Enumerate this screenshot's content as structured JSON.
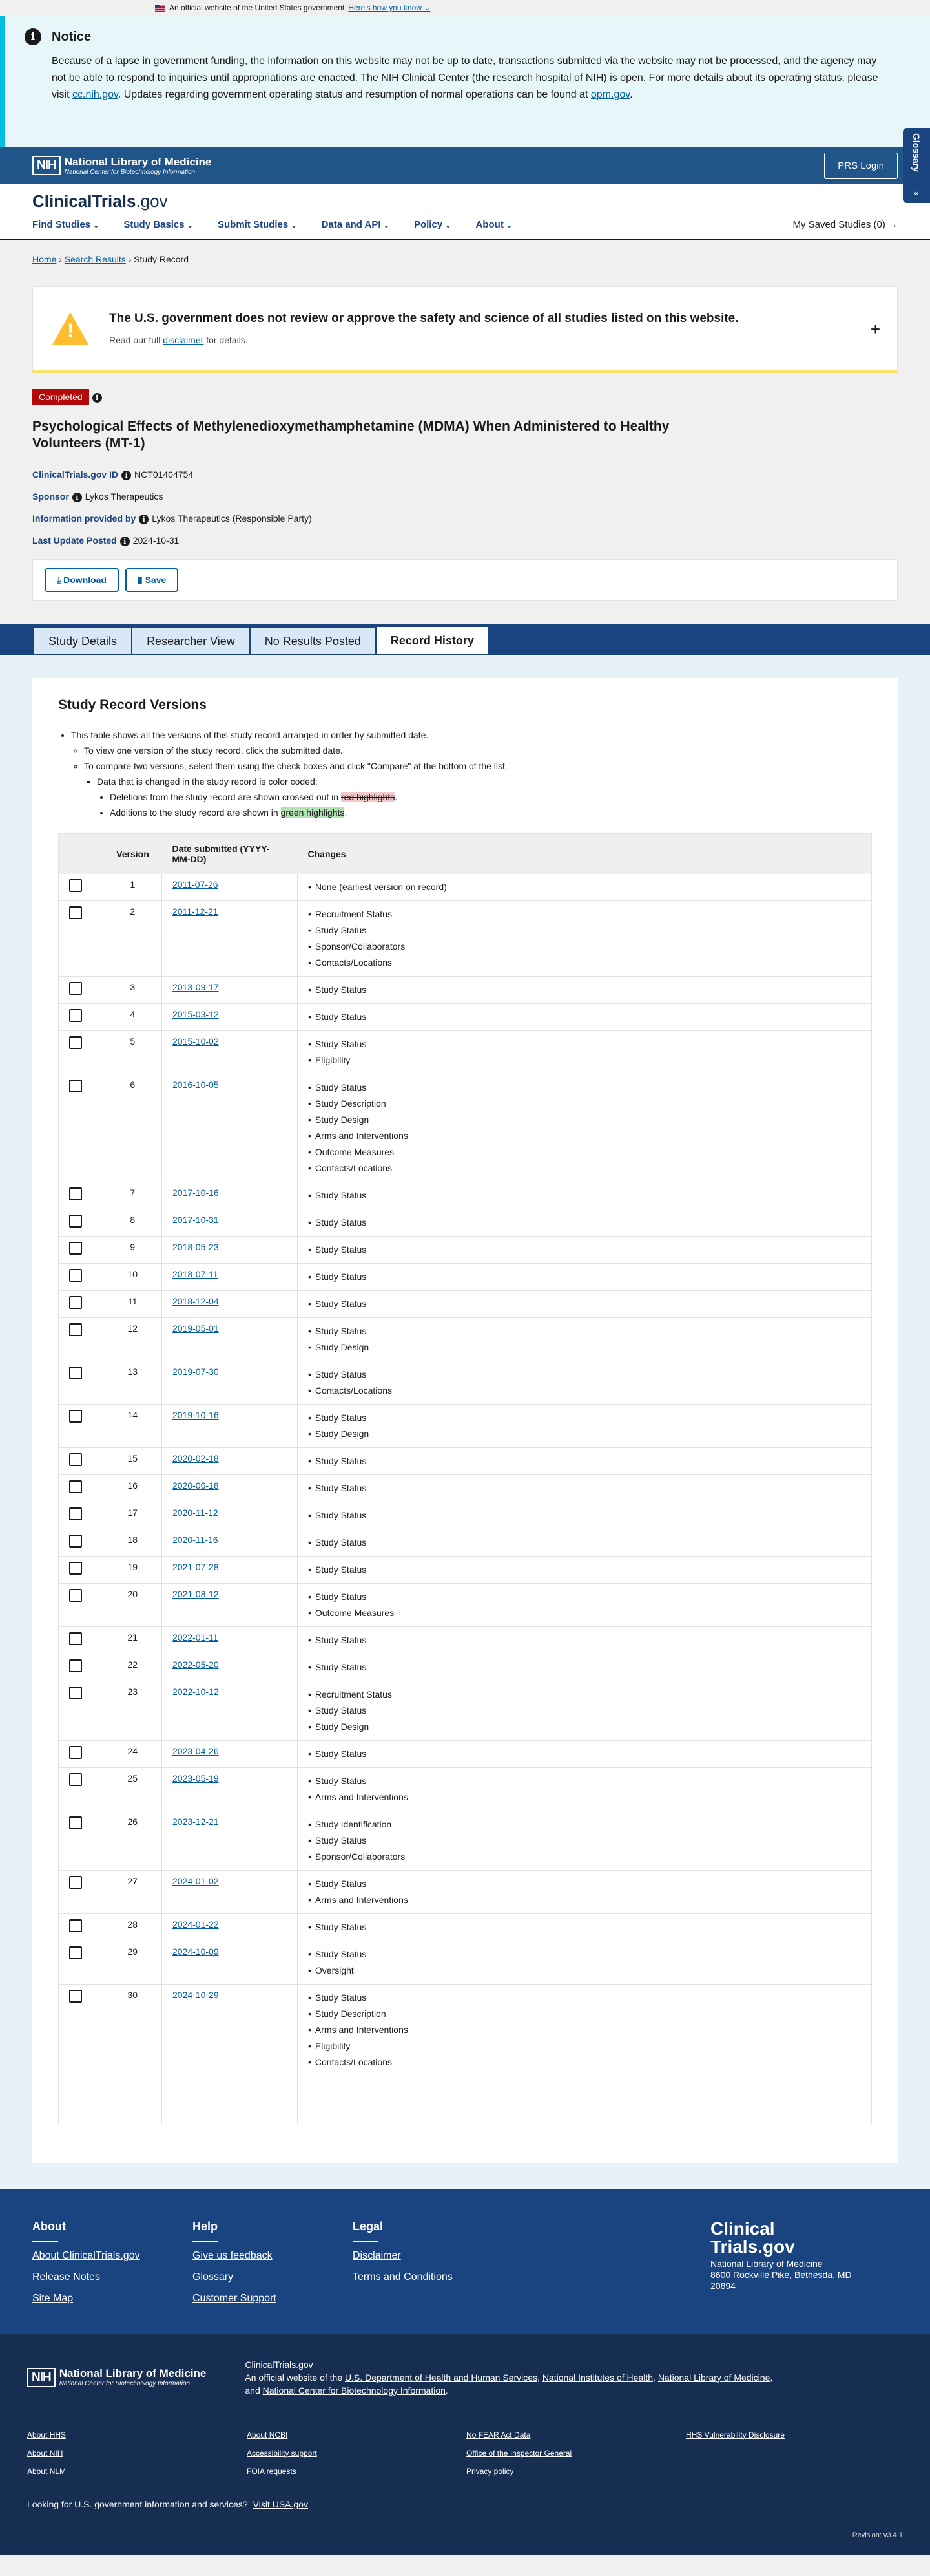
{
  "gov_banner": {
    "text": "An official website of the United States government",
    "link": "Here's how you know ⌄"
  },
  "notice": {
    "title": "Notice",
    "body": "Because of a lapse in government funding, the information on this website may not be up to date, transactions submitted via the website may not be processed, and the agency may not be able to respond to inquiries until appropriations are enacted. The NIH Clinical Center (the research hospital of NIH) is open. For more details about its operating status, please visit ",
    "link1": "cc.nih.gov",
    "body2": ". Updates regarding government operating status and resumption of normal operations can be found at ",
    "link2": "opm.gov",
    "end": "."
  },
  "nih": {
    "mark": "NIH",
    "line1": "National Library of Medicine",
    "line2": "National Center for Biotechnology Information",
    "prs": "PRS Login"
  },
  "glossary_tab": {
    "label": "Glossary",
    "arrow": "«"
  },
  "brand": {
    "main": "ClinicalTrials",
    "suffix": ".gov"
  },
  "nav": {
    "items": [
      "Find Studies",
      "Study Basics",
      "Submit Studies",
      "Data and API",
      "Policy",
      "About"
    ],
    "saved": "My Saved Studies (0) →"
  },
  "breadcrumb": {
    "home": "Home",
    "search": "Search Results",
    "current": "Study Record"
  },
  "warning": {
    "title": "The U.S. government does not review or approve the safety and science of all studies listed on this website.",
    "pre": "Read our full ",
    "link": "disclaimer",
    "post": " for details.",
    "icon": "!",
    "toggle": "+"
  },
  "study": {
    "status": "Completed",
    "title": "Psychological Effects of Methylenedioxymethamphetamine (MDMA) When Administered to Healthy Volunteers (MT-1)",
    "id_label": "ClinicalTrials.gov ID",
    "id": "NCT01404754",
    "sponsor_label": "Sponsor",
    "sponsor": "Lykos Therapeutics",
    "provided_label": "Information provided by",
    "provided": "Lykos Therapeutics (Responsible Party)",
    "update_label": "Last Update Posted",
    "update": "2024-10-31"
  },
  "actions": {
    "download": "Download",
    "save": "Save"
  },
  "tabs": [
    {
      "label": "Study Details"
    },
    {
      "label": "Researcher View"
    },
    {
      "label": "No Results Posted"
    },
    {
      "label": "Record History"
    }
  ],
  "versions": {
    "title": "Study Record Versions",
    "n1": "This table shows all the versions of this study record arranged in order by submitted date.",
    "n2": "To view one version of the study record, click the submitted date.",
    "n3": "To compare two versions, select them using the check boxes and click \"Compare\" at the bottom of the list.",
    "n4": "Data that is changed in the study record is color coded:",
    "n5_pre": "Deletions from the study record are shown crossed out in ",
    "n5_hl": "red highlights",
    "n5_post": ".",
    "n6_pre": "Additions to the study record are shown in ",
    "n6_hl": "green highlights",
    "n6_post": ".",
    "headers": {
      "version": "Version",
      "date": "Date submitted (YYYY-MM-DD)",
      "changes": "Changes"
    },
    "rows": [
      {
        "v": "1",
        "d": "2011-07-26",
        "c": [
          "None (earliest version on record)"
        ]
      },
      {
        "v": "2",
        "d": "2011-12-21",
        "c": [
          "Recruitment Status",
          "Study Status",
          "Sponsor/Collaborators",
          "Contacts/Locations"
        ]
      },
      {
        "v": "3",
        "d": "2013-09-17",
        "c": [
          "Study Status"
        ]
      },
      {
        "v": "4",
        "d": "2015-03-12",
        "c": [
          "Study Status"
        ]
      },
      {
        "v": "5",
        "d": "2015-10-02",
        "c": [
          "Study Status",
          "Eligibility"
        ]
      },
      {
        "v": "6",
        "d": "2016-10-05",
        "c": [
          "Study Status",
          "Study Description",
          "Study Design",
          "Arms and Interventions",
          "Outcome Measures",
          "Contacts/Locations"
        ]
      },
      {
        "v": "7",
        "d": "2017-10-16",
        "c": [
          "Study Status"
        ]
      },
      {
        "v": "8",
        "d": "2017-10-31",
        "c": [
          "Study Status"
        ]
      },
      {
        "v": "9",
        "d": "2018-05-23",
        "c": [
          "Study Status"
        ]
      },
      {
        "v": "10",
        "d": "2018-07-11",
        "c": [
          "Study Status"
        ]
      },
      {
        "v": "11",
        "d": "2018-12-04",
        "c": [
          "Study Status"
        ]
      },
      {
        "v": "12",
        "d": "2019-05-01",
        "c": [
          "Study Status",
          "Study Design"
        ]
      },
      {
        "v": "13",
        "d": "2019-07-30",
        "c": [
          "Study Status",
          "Contacts/Locations"
        ]
      },
      {
        "v": "14",
        "d": "2019-10-16",
        "c": [
          "Study Status",
          "Study Design"
        ]
      },
      {
        "v": "15",
        "d": "2020-02-18",
        "c": [
          "Study Status"
        ]
      },
      {
        "v": "16",
        "d": "2020-06-18",
        "c": [
          "Study Status"
        ]
      },
      {
        "v": "17",
        "d": "2020-11-12",
        "c": [
          "Study Status"
        ]
      },
      {
        "v": "18",
        "d": "2020-11-16",
        "c": [
          "Study Status"
        ]
      },
      {
        "v": "19",
        "d": "2021-07-28",
        "c": [
          "Study Status"
        ]
      },
      {
        "v": "20",
        "d": "2021-08-12",
        "c": [
          "Study Status",
          "Outcome Measures"
        ]
      },
      {
        "v": "21",
        "d": "2022-01-11",
        "c": [
          "Study Status"
        ]
      },
      {
        "v": "22",
        "d": "2022-05-20",
        "c": [
          "Study Status"
        ]
      },
      {
        "v": "23",
        "d": "2022-10-12",
        "c": [
          "Recruitment Status",
          "Study Status",
          "Study Design"
        ]
      },
      {
        "v": "24",
        "d": "2023-04-26",
        "c": [
          "Study Status"
        ]
      },
      {
        "v": "25",
        "d": "2023-05-19",
        "c": [
          "Study Status",
          "Arms and Interventions"
        ]
      },
      {
        "v": "26",
        "d": "2023-12-21",
        "c": [
          "Study Identification",
          "Study Status",
          "Sponsor/Collaborators"
        ]
      },
      {
        "v": "27",
        "d": "2024-01-02",
        "c": [
          "Study Status",
          "Arms and Interventions"
        ]
      },
      {
        "v": "28",
        "d": "2024-01-22",
        "c": [
          "Study Status"
        ]
      },
      {
        "v": "29",
        "d": "2024-10-09",
        "c": [
          "Study Status",
          "Oversight"
        ]
      },
      {
        "v": "30",
        "d": "2024-10-29",
        "c": [
          "Study Status",
          "Study Description",
          "Arms and Interventions",
          "Eligibility",
          "Contacts/Locations"
        ]
      }
    ]
  },
  "footer": {
    "about": {
      "title": "About",
      "links": [
        "About ClinicalTrials.gov",
        "Release Notes",
        "Site Map"
      ]
    },
    "help": {
      "title": "Help",
      "links": [
        "Give us feedback",
        "Glossary",
        "Customer Support"
      ]
    },
    "legal": {
      "title": "Legal",
      "links": [
        "Disclaimer",
        "Terms and Conditions"
      ]
    },
    "brand1": "Clinical",
    "brand2": "Trials.gov",
    "addr1": "National Library of Medicine",
    "addr2": "8600 Rockville Pike, Bethesda, MD",
    "addr3": "20894",
    "ct": "ClinicalTrials.gov",
    "official_pre": "An official website of the ",
    "hhs": "U.S. Department of Health and Human Services",
    "nih": "National Institutes of Health",
    "nlm": "National Library of Medicine",
    "ncbi": "National Center for Biotechnology Information",
    "links": [
      "About HHS",
      "About NCBI",
      "No FEAR Act Data",
      "HHS Vulnerability Disclosure",
      "About NIH",
      "Accessibility support",
      "Office of the Inspector General",
      "",
      "About NLM",
      "FOIA requests",
      "Privacy policy",
      ""
    ],
    "usa_q": "Looking for U.S. government information and services?",
    "usa_link": "Visit USA.gov",
    "revision": "Revision: v3.4.1"
  }
}
